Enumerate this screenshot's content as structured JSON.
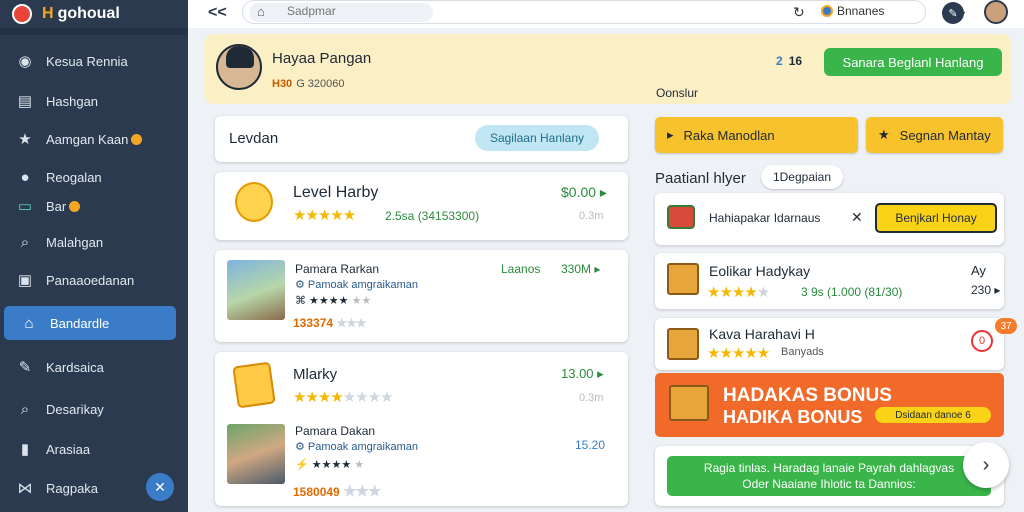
{
  "app": {
    "brand_mark": "H",
    "title": "gohoual"
  },
  "sidebar": {
    "items": [
      {
        "label": "Kesua Rennia",
        "icon": "globe-icon"
      },
      {
        "label": "Hashgan",
        "icon": "list-icon"
      },
      {
        "label": "Aamgan Kaan",
        "icon": "star-icon",
        "coin": true
      },
      {
        "label": "Reogalan",
        "icon": "user-icon"
      },
      {
        "label": "Bar",
        "icon": "card-icon",
        "coin": true
      },
      {
        "label": "Malahgan",
        "icon": "search-icon"
      },
      {
        "label": "Panaaoedanan",
        "icon": "window-icon"
      },
      {
        "label": "Bandardle",
        "icon": "home-icon",
        "active": true
      },
      {
        "label": "Kardsaica",
        "icon": "pen-icon"
      },
      {
        "label": "Desarikay",
        "icon": "search-icon"
      },
      {
        "label": "Arasiaa",
        "icon": "lock-icon"
      },
      {
        "label": "Ragpaka",
        "icon": "share-icon"
      }
    ]
  },
  "topbar": {
    "back": "<<",
    "search_placeholder": "Sadpmar",
    "region": "Bnnanes"
  },
  "profile": {
    "name": "Hayaa Pangan",
    "level": "H30",
    "sub": "G 320060",
    "stat_a": "2",
    "stat_b": "16",
    "button": "Sanara Beglanl Hanlang",
    "label": "Oonslur"
  },
  "left": {
    "header_title": "Levdan",
    "header_button": "Sagilaan Hanlany",
    "level_card": {
      "title": "Level Harby",
      "meta": "2.5sa (34153300)",
      "price": "$0.00",
      "sub": "0.3m"
    },
    "item1": {
      "title": "Pamara Rarkan",
      "sub": "Pamoak amgraikaman",
      "score": "133374",
      "badge": "Laanos",
      "price": "330M"
    },
    "market": {
      "title": "Mlarky",
      "price": "13.00",
      "sub": "0.3m"
    },
    "item2": {
      "title": "Pamara Dakan",
      "sub": "Pamoak amgraikaman",
      "score": "1580049",
      "price": "15.20"
    }
  },
  "right": {
    "btn1": "Raka Manodlan",
    "btn2": "Segnan Mantay",
    "ref_head": "Paatianl hlyer",
    "ref_chip": "1Degpaian",
    "row1": {
      "text": "Hahiapakar Idarnaus",
      "button": "Benjkarl Honay"
    },
    "row2": {
      "title": "Eolikar Hadykay",
      "meta": "3 9s (1.000 (81/30)",
      "a1": "Ay",
      "a2": "230"
    },
    "row3": {
      "title": "Kava Harahavi H",
      "meta": "Banyads",
      "notif": "0",
      "count": "37"
    },
    "bonus": {
      "h1": "HADAKAS BONUS",
      "h2": "HADIKA BONUS",
      "pill": "Dsidaan danoe 6"
    },
    "green": {
      "line1": "Ragia tinlas. Haradag lanaie Payrah dahlagvas",
      "line2": "Oder Naaiane Ihlotic ta Dannios:"
    }
  }
}
